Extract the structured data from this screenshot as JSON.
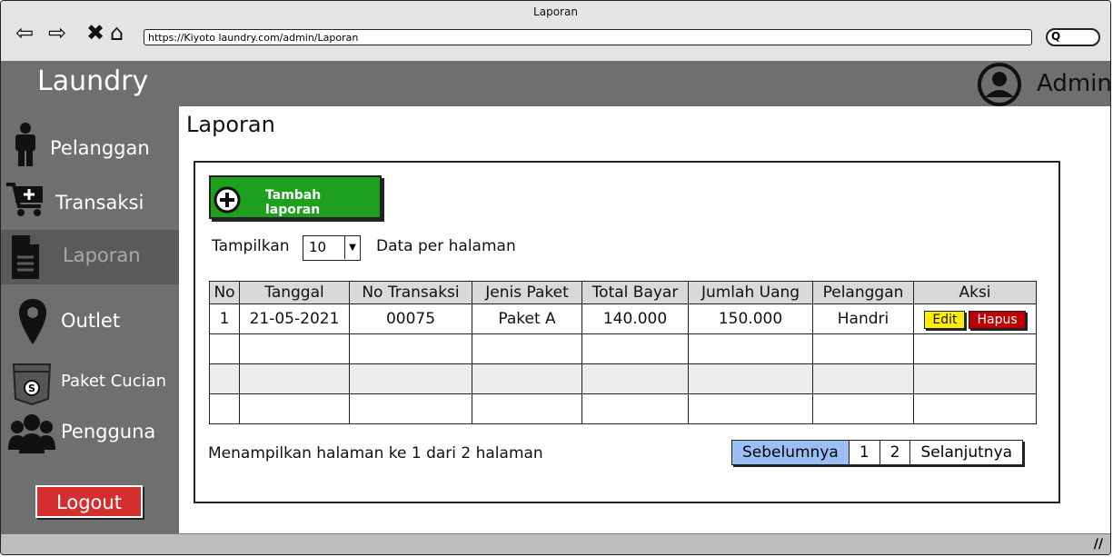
{
  "window": {
    "title": "Laporan",
    "url": "https://Kiyoto laundry.com/admin/Laporan",
    "search_glyph": "Q"
  },
  "header": {
    "brand": "Laundry",
    "user": "Admin"
  },
  "sidebar": {
    "items": [
      {
        "label": "Pelanggan",
        "icon": "person-icon"
      },
      {
        "label": "Transaksi",
        "icon": "cart-icon"
      },
      {
        "label": "Laporan",
        "icon": "document-icon",
        "active": true
      },
      {
        "label": "Outlet",
        "icon": "map-pin-icon"
      },
      {
        "label": "Paket Cucian",
        "icon": "package-icon"
      },
      {
        "label": "Pengguna",
        "icon": "users-icon"
      }
    ],
    "logout": "Logout"
  },
  "main": {
    "title": "Laporan",
    "add_button": "Tambah laporan",
    "show_label": "Tampilkan",
    "per_page_value": "10",
    "per_page_label": "Data per halaman",
    "table": {
      "headers": [
        "No",
        "Tanggal",
        "No Transaksi",
        "Jenis Paket",
        "Total Bayar",
        "Jumlah Uang",
        "Pelanggan",
        "Aksi"
      ],
      "rows": [
        [
          "1",
          "21-05-2021",
          "00075",
          "Paket A",
          "140.000",
          "150.000",
          "Handri"
        ]
      ],
      "edit_label": "Edit",
      "delete_label": "Hapus"
    },
    "info": "Menampilkan halaman ke 1 dari 2 halaman",
    "pager": {
      "prev": "Sebelumnya",
      "pages": [
        "1",
        "2"
      ],
      "next": "Selanjutnya"
    }
  },
  "colors": {
    "header_bg": "#6f6f6f",
    "add_button": "#1ea01e",
    "logout": "#d32f2f",
    "edit": "#ffee00",
    "delete": "#c00000",
    "pager_active": "#99bff5"
  }
}
